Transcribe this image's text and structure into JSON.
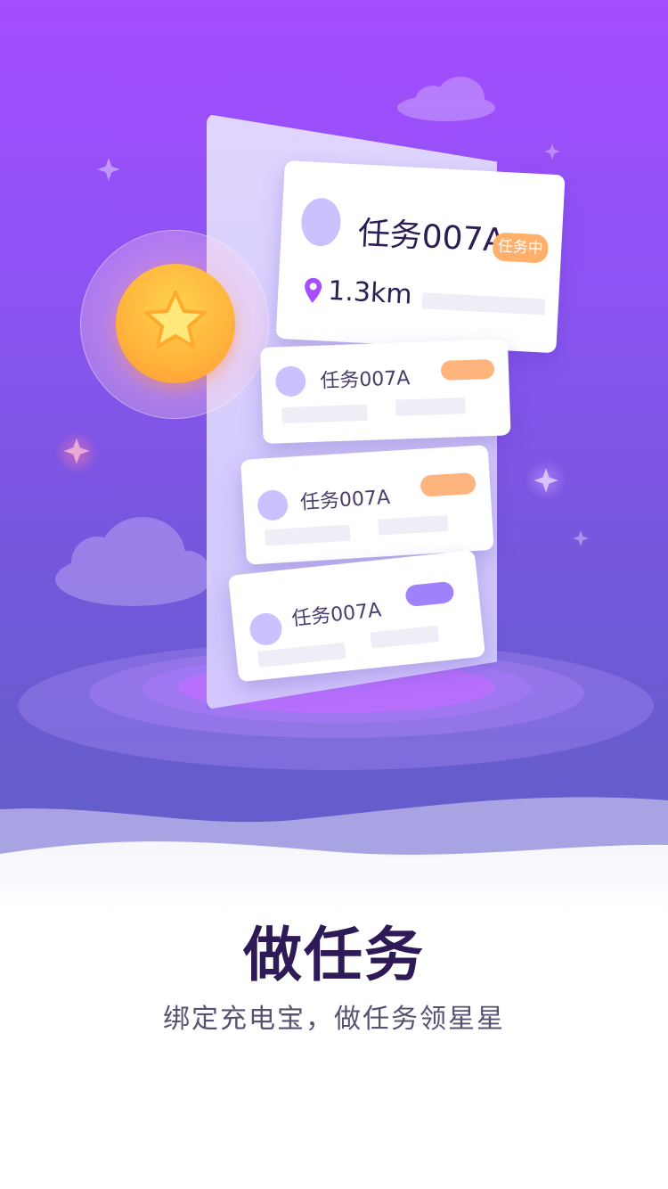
{
  "colors": {
    "bg_top": "#a44cff",
    "bg_bottom": "#5f5fc6",
    "pill_orange": "#ffb16b",
    "pill_purple": "#9f82fb",
    "headline": "#2e1a57",
    "subline": "#5a5170"
  },
  "cards": [
    {
      "title": "任务007A",
      "status": "任务中",
      "distance": "1.3km",
      "location_icon": "location-pin-icon"
    },
    {
      "title": "任务007A"
    },
    {
      "title": "任务007A"
    },
    {
      "title": "任务007A"
    }
  ],
  "illustration": {
    "coin_icon": "star-icon"
  },
  "headline": "做任务",
  "subline": "绑定充电宝，做任务领星星"
}
